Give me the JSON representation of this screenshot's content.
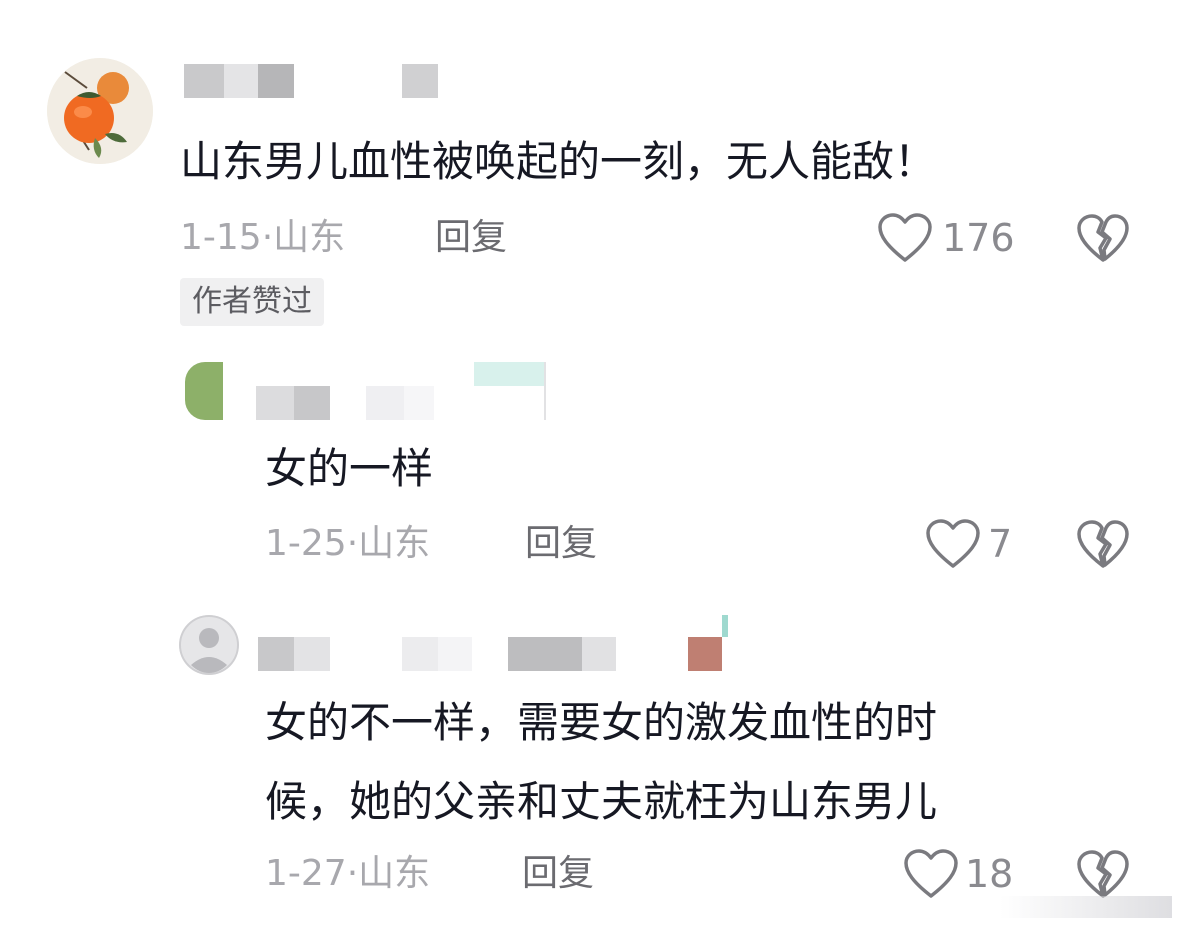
{
  "comments": [
    {
      "text": "山东男儿血性被唤起的一刻，无人能敌！",
      "date": "1-15·",
      "region": "山东",
      "reply_label": "回复",
      "likes": "176",
      "badge": "作者赞过"
    },
    {
      "text": "女的一样",
      "date": "1-25·",
      "region": "山东",
      "reply_label": "回复",
      "likes": "7"
    },
    {
      "text_line1": "女的不一样，需要女的激发血性的时",
      "text_line2": "候，她的父亲和丈夫就枉为山东男儿",
      "date": "1-27·",
      "region": "山东",
      "reply_label": "回复",
      "likes": "18"
    }
  ],
  "icons": {
    "like": "heart-outline-icon",
    "dislike": "broken-heart-icon",
    "avatar_default": "default-user-avatar"
  },
  "colors": {
    "primary_text": "#161823",
    "meta_text": "#a8a8ad",
    "icon_gray": "#7a7a7f",
    "badge_bg": "#f0f0f1"
  }
}
